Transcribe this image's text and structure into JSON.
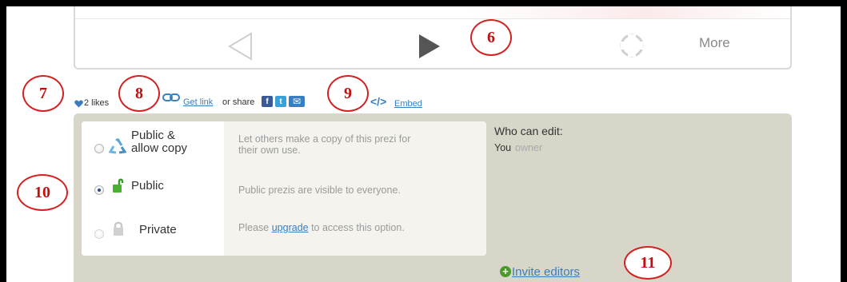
{
  "player": {
    "more_label": "More",
    "icons": [
      "previous-icon",
      "play-icon",
      "fullscreen-icon"
    ]
  },
  "callouts": [
    "6",
    "7",
    "8",
    "9",
    "10",
    "11"
  ],
  "share": {
    "likes": "2 likes",
    "get_link": "Get link",
    "or_share": "or share",
    "embed_symbol": "</>",
    "embed": "Embed",
    "social": [
      {
        "name": "facebook",
        "glyph": "f",
        "color": "#3b5998"
      },
      {
        "name": "twitter",
        "glyph": "t",
        "color": "#3aa0d8"
      },
      {
        "name": "email",
        "glyph": "✉",
        "color": "#3a7ebf"
      }
    ]
  },
  "privacy": {
    "options": [
      {
        "label_line1": "Public &",
        "label_line2": "allow copy",
        "desc_line1": "Let others make a copy of this prezi for",
        "desc_line2": "their own use.",
        "checked": false
      },
      {
        "label_line1": "Public",
        "desc_line1": "Public prezis are visible to everyone.",
        "checked": true
      },
      {
        "label_line1": "Private",
        "desc_pre": "Please",
        "desc_link": "upgrade",
        "desc_post": "to access this option.",
        "checked": false
      }
    ]
  },
  "editors": {
    "title": "Who can edit:",
    "you": "You",
    "role": "owner",
    "invite": "Invite editors"
  },
  "colors": {
    "callout": "#d42020",
    "link": "#3a7ebf",
    "panel_bg": "#d8d6c8"
  }
}
